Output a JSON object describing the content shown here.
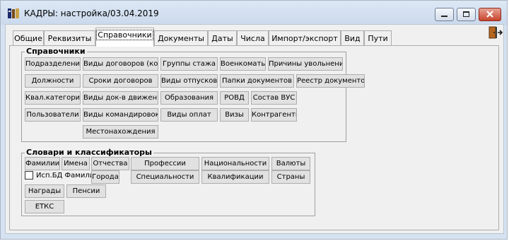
{
  "window": {
    "title": "КАДРЫ: настройка/03.04.2019",
    "icons": [
      "app-icon",
      "minimize-icon",
      "maximize-icon",
      "close-icon",
      "exit-door-icon"
    ]
  },
  "tabs": [
    "Общие",
    "Реквизиты",
    "Справочники",
    "Документы",
    "Даты",
    "Числа",
    "Импорт/экспорт",
    "Вид",
    "Пути"
  ],
  "active_tab": "Справочники",
  "reference": {
    "label": "Справочники",
    "buttons": [
      "Подразделения",
      "Виды договоров (контр.)",
      "Группы стажа",
      "Военкоматы",
      "Причины увольнений",
      "Должности",
      "Сроки договоров",
      "Виды отпусков",
      "Папки документов",
      "Реестр документов",
      "Квал.категории",
      "Виды док-в движения",
      "Образования",
      "РОВД",
      "Состав ВУС",
      "Пользователи",
      "Виды командировок",
      "Виды оплат",
      "Визы",
      "Контрагенты",
      "Местонахождения"
    ]
  },
  "dictionaries": {
    "label": "Словари и классификаторы",
    "buttons": [
      "Фамилии",
      "Имена",
      "Отчества",
      "Профессии",
      "Национальности",
      "Валюты",
      "Города",
      "Специальности",
      "Квалификации",
      "Страны",
      "Награды",
      "Пенсии",
      "ЕТКС"
    ],
    "checkbox_label": "Исп.БД Фамилии",
    "checkbox_checked": false
  }
}
